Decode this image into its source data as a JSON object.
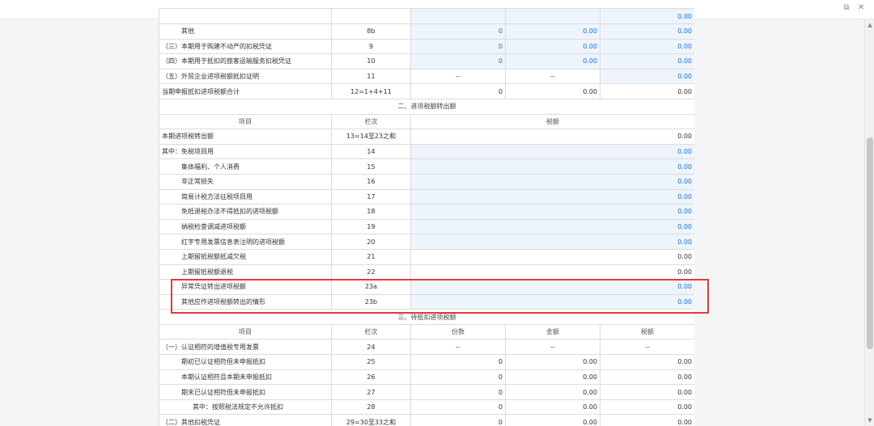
{
  "window": {
    "icons": [
      "restore-icon",
      "close-icon"
    ]
  },
  "table1_rows": [
    {
      "item": "",
      "col": "",
      "c3": "",
      "c4": "",
      "c5": "0.00",
      "type": "partial"
    },
    {
      "item": "其他",
      "col": "8b",
      "c3": "0",
      "c4": "0.00",
      "c5": "0.00",
      "type": "ind"
    },
    {
      "item": "（三）本期用于购建不动产的扣税凭证",
      "col": "9",
      "c3": "0",
      "c4": "0.00",
      "c5": "0.00"
    },
    {
      "item": "（四）本期用于抵扣的旅客运输服务扣税凭证",
      "col": "10",
      "c3": "0",
      "c4": "0.00",
      "c5": "0.00"
    },
    {
      "item": "（五）外贸企业进项税额抵扣证明",
      "col": "11",
      "c3": "--",
      "c4": "--",
      "c5": "0.00",
      "type": "dash"
    },
    {
      "item": "当期申报抵扣进项税额合计",
      "col": "12=1+4+11",
      "c3": "0",
      "c4": "0.00",
      "c5": "0.00",
      "type": "total"
    }
  ],
  "section2": {
    "title": "二、进项税额转出额",
    "header": {
      "item": "项目",
      "col": "栏次",
      "amount": "税额"
    },
    "rows": [
      {
        "item": "本期进项税转出额",
        "col": "13=14至23之和",
        "amount": "0.00",
        "indent": 0,
        "editable": false
      },
      {
        "item": "其中：免税项目用",
        "col": "14",
        "amount": "0.00",
        "indent": 0,
        "editable": true
      },
      {
        "item": "集体福利、个人消费",
        "col": "15",
        "amount": "0.00",
        "indent": 1,
        "editable": true
      },
      {
        "item": "非正常损失",
        "col": "16",
        "amount": "0.00",
        "indent": 1,
        "editable": true
      },
      {
        "item": "简易计税方法征税项目用",
        "col": "17",
        "amount": "0.00",
        "indent": 1,
        "editable": true
      },
      {
        "item": "免抵退税办法不得抵扣的进项税额",
        "col": "18",
        "amount": "0.00",
        "indent": 1,
        "editable": true
      },
      {
        "item": "纳税检查调减进项税额",
        "col": "19",
        "amount": "0.00",
        "indent": 1,
        "editable": true
      },
      {
        "item": "红字专用发票信息表注明的进项税额",
        "col": "20",
        "amount": "0.00",
        "indent": 1,
        "editable": true
      },
      {
        "item": "上期留抵税额抵减欠税",
        "col": "21",
        "amount": "0.00",
        "indent": 1,
        "editable": false
      },
      {
        "item": "上期留抵税额退税",
        "col": "22",
        "amount": "0.00",
        "indent": 1,
        "editable": false
      },
      {
        "item": "异常凭证转出进项税额",
        "col": "23a",
        "amount": "0.00",
        "indent": 1,
        "editable": true
      },
      {
        "item": "其他应作进项税额转出的情形",
        "col": "23b",
        "amount": "0.00",
        "indent": 1,
        "editable": true
      }
    ]
  },
  "section3": {
    "title": "三、待抵扣进项税额",
    "header": {
      "item": "项目",
      "col": "栏次",
      "count": "份数",
      "money": "金额",
      "tax": "税额"
    },
    "rows": [
      {
        "item": "（一）认证相符的增值税专用发票",
        "col": "24",
        "count": "--",
        "money": "--",
        "tax": "--",
        "indent": 0
      },
      {
        "item": "期初已认证相符但未申报抵扣",
        "col": "25",
        "count": "0",
        "money": "0.00",
        "tax": "0.00",
        "indent": 1
      },
      {
        "item": "本期认证相符且本期未申报抵扣",
        "col": "26",
        "count": "0",
        "money": "0.00",
        "tax": "0.00",
        "indent": 1
      },
      {
        "item": "期末已认证相符但未申报抵扣",
        "col": "27",
        "count": "0",
        "money": "0.00",
        "tax": "0.00",
        "indent": 1
      },
      {
        "item": "其中：按照税法规定不允许抵扣",
        "col": "28",
        "count": "0",
        "money": "0.00",
        "tax": "0.00",
        "indent": 2
      },
      {
        "item": "（二）其他扣税凭证",
        "col": "29=30至33之和",
        "count": "0",
        "money": "0.00",
        "tax": "0.00",
        "indent": 0
      }
    ]
  }
}
